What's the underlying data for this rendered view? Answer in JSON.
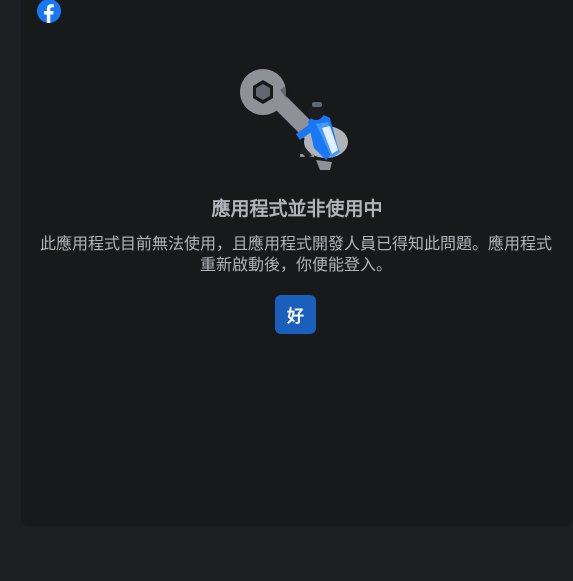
{
  "dialog": {
    "title": "應用程式並非使用中",
    "message": "此應用程式目前無法使用，且應用程式開發人員已得知此問題。應用程式重新啟動後，你便能登入。",
    "ok_label": "好"
  },
  "icons": {
    "logo": "facebook-logo-icon",
    "illustration": "wrench-maintenance-illustration"
  },
  "colors": {
    "page_background": "#1c1e21",
    "card_background": "#18191a",
    "text": "#b0b3b8",
    "button": "#1b5fbd",
    "facebook_blue": "#1877f2"
  }
}
